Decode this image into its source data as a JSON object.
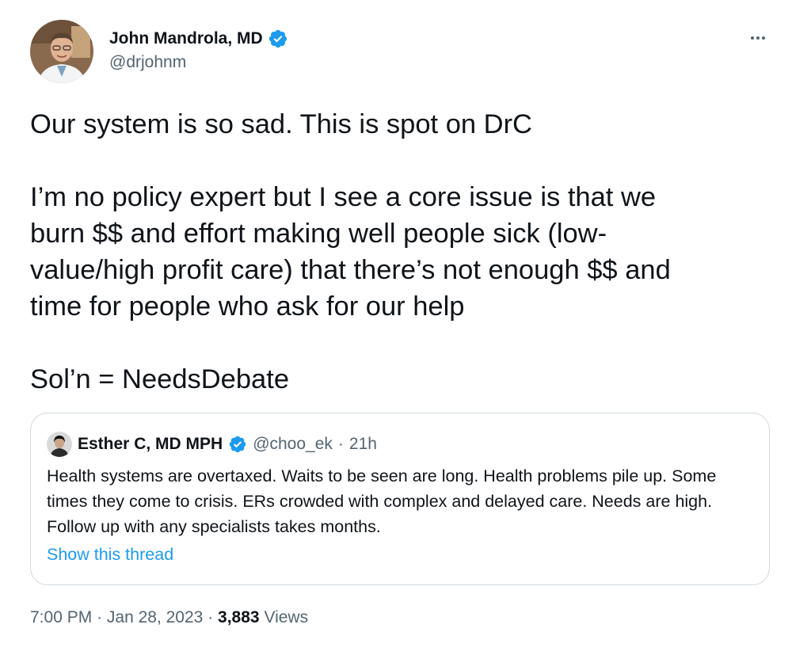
{
  "author": {
    "display_name": "John Mandrola, MD",
    "handle": "@drjohnm",
    "verified": true
  },
  "tweet": {
    "line1": "Our system is so sad. This is spot on DrC",
    "paragraph2": "I’m no policy expert but I see a core issue is that we\nburn $$ and effort making well people sick (low-\nvalue/high profit care) that there’s not enough $$ and\ntime for people who ask for our help",
    "line3": "Sol’n = NeedsDebate"
  },
  "quoted": {
    "display_name": "Esther C, MD MPH",
    "handle": "@choo_ek",
    "separator": "·",
    "time": "21h",
    "text": "Health systems are overtaxed. Waits to be seen are long. Health problems pile up. Some times they come to crisis. ERs crowded with complex and delayed care. Needs are high. Follow up with any specialists takes months.",
    "show_thread": "Show this thread"
  },
  "meta": {
    "time": "7:00 PM",
    "sep1": "·",
    "date": "Jan 28, 2023",
    "sep2": "·",
    "views_count": "3,883",
    "views_label": "Views"
  },
  "colors": {
    "accent": "#1d9bf0",
    "text": "#0f1419",
    "secondary": "#536471",
    "border": "#cfd9de"
  },
  "icons": {
    "verified": "verified-badge-icon",
    "more": "more-options-icon"
  }
}
